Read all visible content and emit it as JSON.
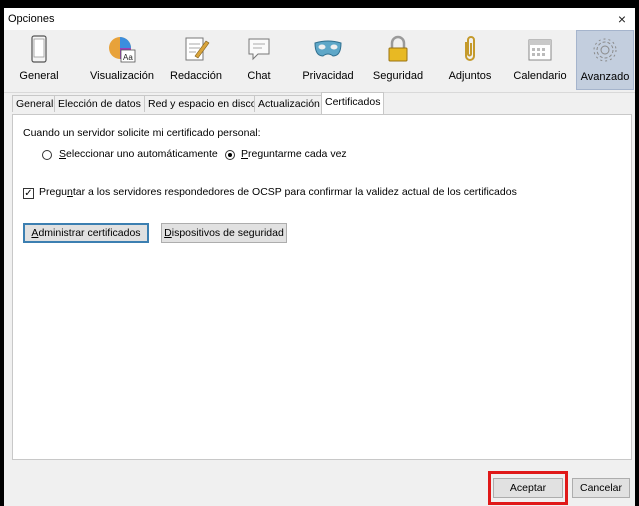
{
  "window": {
    "title": "Opciones",
    "close": "×"
  },
  "toolbar": [
    {
      "label": "General",
      "icon": "phone-icon"
    },
    {
      "label": "Visualización",
      "icon": "display-icon"
    },
    {
      "label": "Redacción",
      "icon": "compose-icon"
    },
    {
      "label": "Chat",
      "icon": "chat-icon"
    },
    {
      "label": "Privacidad",
      "icon": "mask-icon"
    },
    {
      "label": "Seguridad",
      "icon": "lock-icon"
    },
    {
      "label": "Adjuntos",
      "icon": "paperclip-icon"
    },
    {
      "label": "Calendario",
      "icon": "calendar-icon"
    },
    {
      "label": "Avanzado",
      "icon": "gear-icon",
      "active": true
    }
  ],
  "tabs": [
    "General",
    "Elección de datos",
    "Red y espacio en disco",
    "Actualización",
    "Certificados"
  ],
  "active_tab": "Certificados",
  "certs": {
    "intro": "Cuando un servidor solicite mi certificado personal:",
    "radio_auto": "Seleccionar uno automáticamente",
    "radio_ask": "Preguntarme cada vez",
    "ocsp": "Preguntar a los servidores respondedores de OCSP para confirmar la validez actual de los certificados",
    "manage_btn": "Administrar certificados",
    "devices_btn": "Dispositivos de seguridad"
  },
  "footer": {
    "accept": "Aceptar",
    "cancel": "Cancelar"
  },
  "colors": {
    "highlight": "#e01919",
    "active_tab_bg": "#c3cede"
  }
}
